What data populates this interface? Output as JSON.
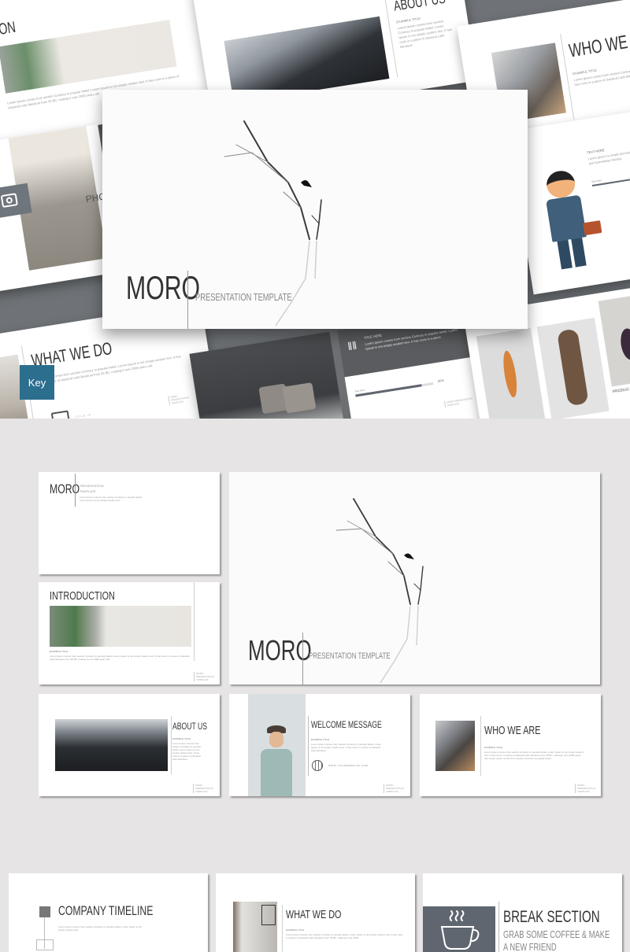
{
  "hero": {
    "main_slide": {
      "title": "MORO",
      "subtitle": "PRESENTATION TEMPLATE"
    },
    "bg_slides": {
      "introduction": {
        "title": "ION",
        "lorem": "Lorem Ipsum comes from section Contrary to popular belief, Lorem Ipsum is not simply random text. It has roots in a piece of classical Latin literature from 45 BC, making it over 2000 years old."
      },
      "about": {
        "title": "ABOUT US",
        "example": "EXAMPLE TITLE",
        "lorem": "Lorem Ipsum comes from section Contrary to popular belief, Lorem Ipsum is not simply random text. It has roots in a piece of classical Latin literature."
      },
      "who": {
        "title": "WHO WE ARE",
        "example": "EXAMPLE TITLE",
        "lorem": "Lorem Ipsum comes from section Contrary to popular belief. It has roots in a piece of classical Latin literature from 45 BC."
      },
      "handshake": {
        "label": "TEXT HERE",
        "lorem": "Lorem Ipsum is simply dummy text of the printing and typesetting industry.",
        "bar_label": "Text Here"
      },
      "photo": {
        "label": "PHO"
      },
      "what": {
        "title": "WHAT WE DO",
        "lorem": "Lorem Ipsum comes from section Contrary to popular belief, Lorem Ipsum is not simply random text. It has roots in a piece of classical Latin literature from 45 BC, making it over 2000 years old.",
        "footer": "MORO PRESENTATION TEMPLATE",
        "icon_label": "TITLE IN"
      },
      "laptop": {
        "label": "TITLE HERE",
        "lorem": "Lorem Ipsum comes from section Contrary to popular belief, Lorem Ipsum is not simply random text. It has roots in a piece.",
        "bar_label": "Text Here",
        "bar_value": "85%",
        "bar_fraction": 0.85,
        "footer": "MORO PRESENTATION TEMPLATE"
      },
      "products": {
        "label": "PRODUC"
      }
    },
    "key_badge": {
      "label": "Key",
      "color": "#2c6e8e"
    }
  },
  "grid": {
    "cover_small": {
      "title": "MORO",
      "subtitle_line1": "PRESENTATION",
      "subtitle_line2": "TEMPLATE",
      "lorem": "Lorem Ipsum comes from section Contrary to popular belief, Lorem Ipsum is not simply random text."
    },
    "introduction": {
      "title": "INTRODUCTION",
      "example": "EXAMPLE TITLE",
      "lorem": "Lorem Ipsum comes from section Contrary to popular belief, Lorem Ipsum is not simply random text. It has roots in a piece of classical Latin literature from 45 BC, making it over 2000 years old.",
      "footer": "MORO PRESENTATION TEMPLATE"
    },
    "cover_large": {
      "title": "MORO",
      "subtitle": "PRESENTATION TEMPLATE"
    },
    "about": {
      "title": "ABOUT US",
      "example": "EXAMPLE TITLE",
      "lorem": "Lorem Ipsum comes from section Contrary to popular belief, Lorem Ipsum is not simply random text. It has roots in a piece of classical Latin literature.",
      "footer": "MORO PRESENTATION TEMPLATE"
    },
    "welcome": {
      "title": "WELCOME MESSAGE",
      "example": "EXAMPLE TITLE",
      "lorem": "Lorem Ipsum comes from section Contrary to popular belief, Lorem Ipsum is not simply random text. It has roots in a piece of classical Latin literature.",
      "website": "WWW.YOURWEBSITE.COM",
      "footer": "MORO PRESENTATION TEMPLATE"
    },
    "who": {
      "title": "WHO WE ARE",
      "example": "EXAMPLE TITLE",
      "lorem": "Lorem Ipsum comes from section Contrary to popular belief, Lorem Ipsum is not simply random text. It has roots in a piece of classical Latin literature from 45 BC, making it over 2000 years old. Lorem Ipsum comes from section Contrary to popular belief.",
      "footer": "MORO PRESENTATION TEMPLATE"
    }
  },
  "bottom": {
    "timeline": {
      "title": "COMPANY TIMELINE",
      "lorem": "Lorem Ipsum comes from section Contrary to popular belief, Lorem Ipsum is not simply random text."
    },
    "what": {
      "title": "WHAT WE DO",
      "example": "EXAMPLE TITLE",
      "lorem": "Lorem Ipsum comes from section Contrary to popular belief, Lorem Ipsum is not simply random text. It has roots in a piece of classical Latin literature from 45 BC, making it over 2000"
    },
    "break": {
      "title": "BREAK SECTION",
      "subtitle_line1": "GRAB SOME COFFEE & MAKE",
      "subtitle_line2": "A NEW FRIEND",
      "icon_bg": "#5f6670"
    }
  }
}
